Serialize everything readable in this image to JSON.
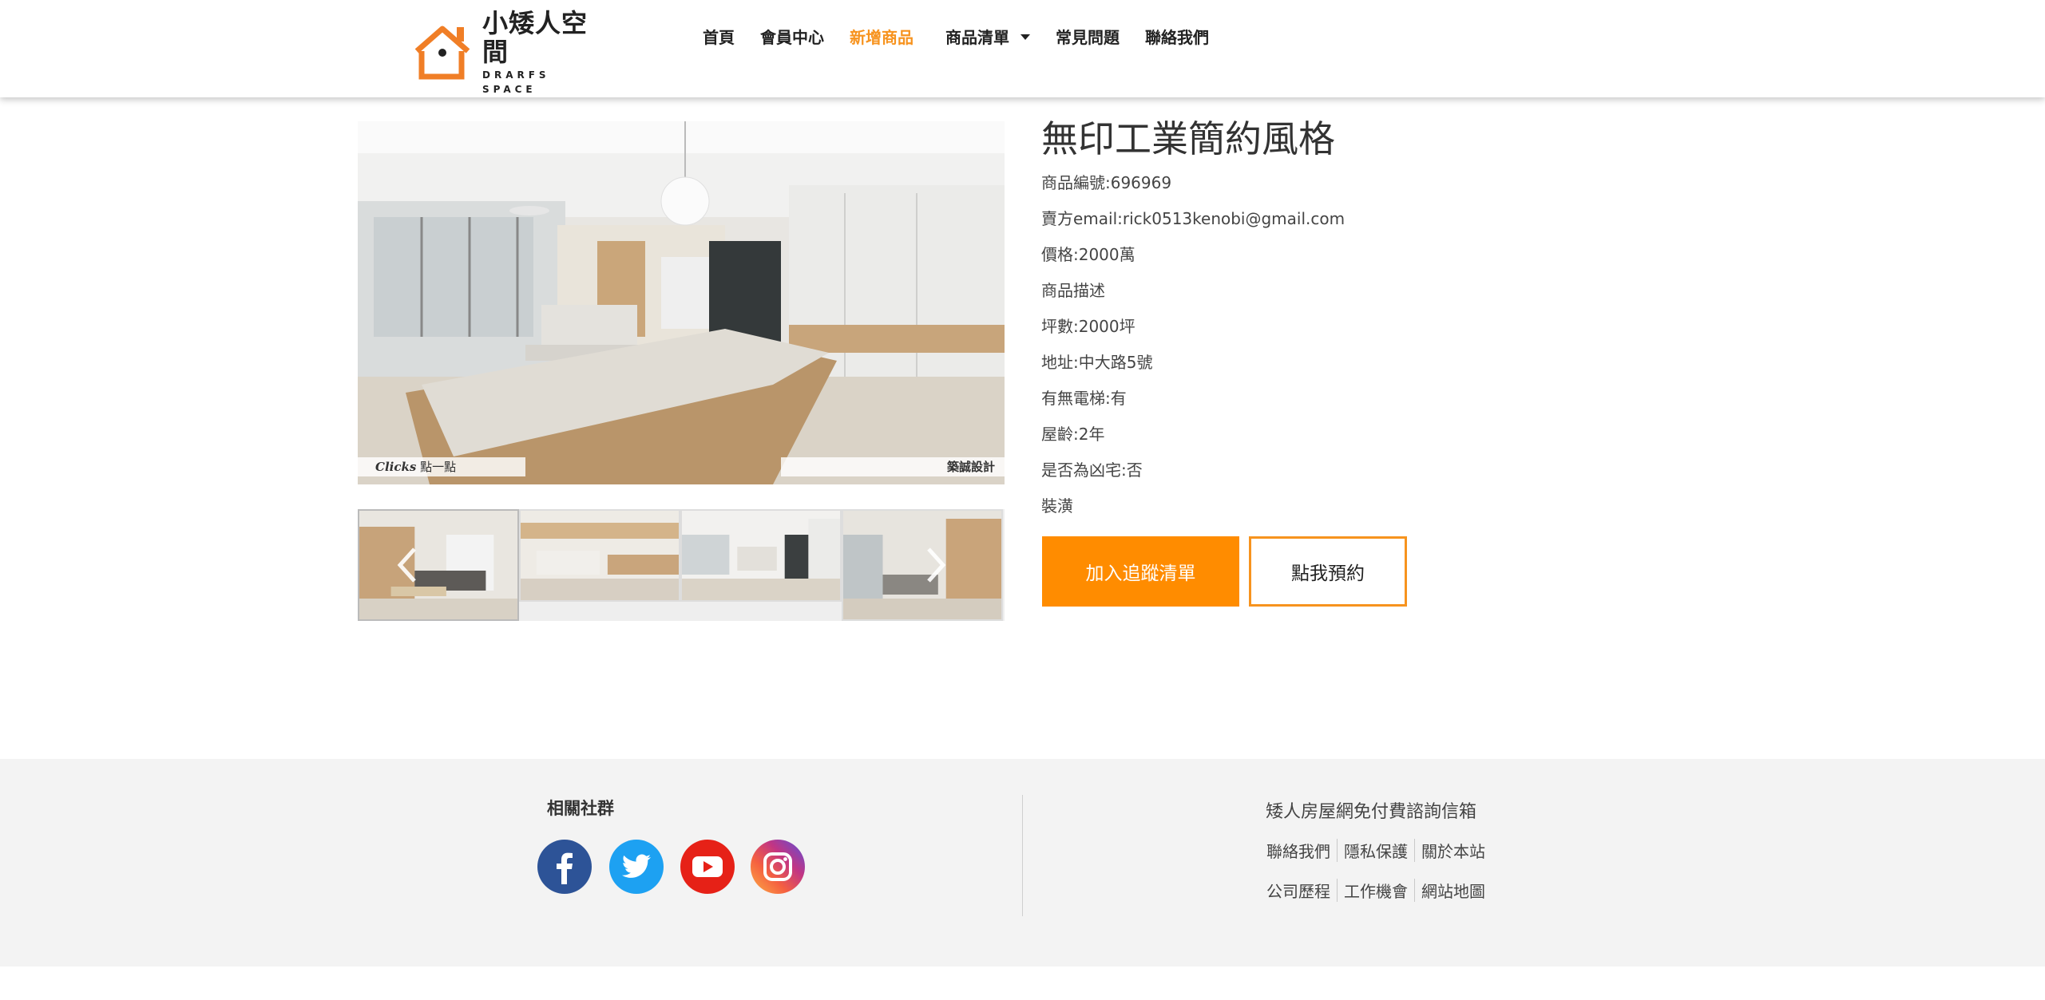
{
  "header": {
    "logo_text": "小矮人空間",
    "logo_subtext": "DRARFS SPACE",
    "nav": [
      {
        "label": "首頁"
      },
      {
        "label": "會員中心"
      },
      {
        "label": "新增商品"
      },
      {
        "label": "商品清單"
      },
      {
        "label": "常見問題"
      },
      {
        "label": "聯絡我們"
      }
    ],
    "active_color": "#f7931e"
  },
  "gallery": {
    "caption_left": "點一點",
    "caption_left_script": "Clicks",
    "caption_right": "築誠設計"
  },
  "product": {
    "title": "無印工業簡約風格",
    "attributes": [
      "商品編號:696969",
      "賣方email:rick0513kenobi@gmail.com",
      "價格:2000萬",
      "商品描述",
      "坪數:2000坪",
      "地址:中大路5號",
      "有無電梯:有",
      "屋齡:2年",
      "是否為凶宅:否",
      "裝潢"
    ],
    "add_to_watchlist": "加入追蹤清單",
    "book_button": "點我預約",
    "accent_color": "#ff8c00"
  },
  "footer": {
    "social_title": "相關社群",
    "social_icons": [
      "facebook-icon",
      "twitter-icon",
      "youtube-icon",
      "instagram-icon"
    ],
    "headline": "矮人房屋網免付費諮詢信箱",
    "links_row1": [
      "聯絡我們",
      "隱私保護",
      "關於本站"
    ],
    "links_row2": [
      "公司歷程",
      "工作機會",
      "網站地圖"
    ]
  }
}
